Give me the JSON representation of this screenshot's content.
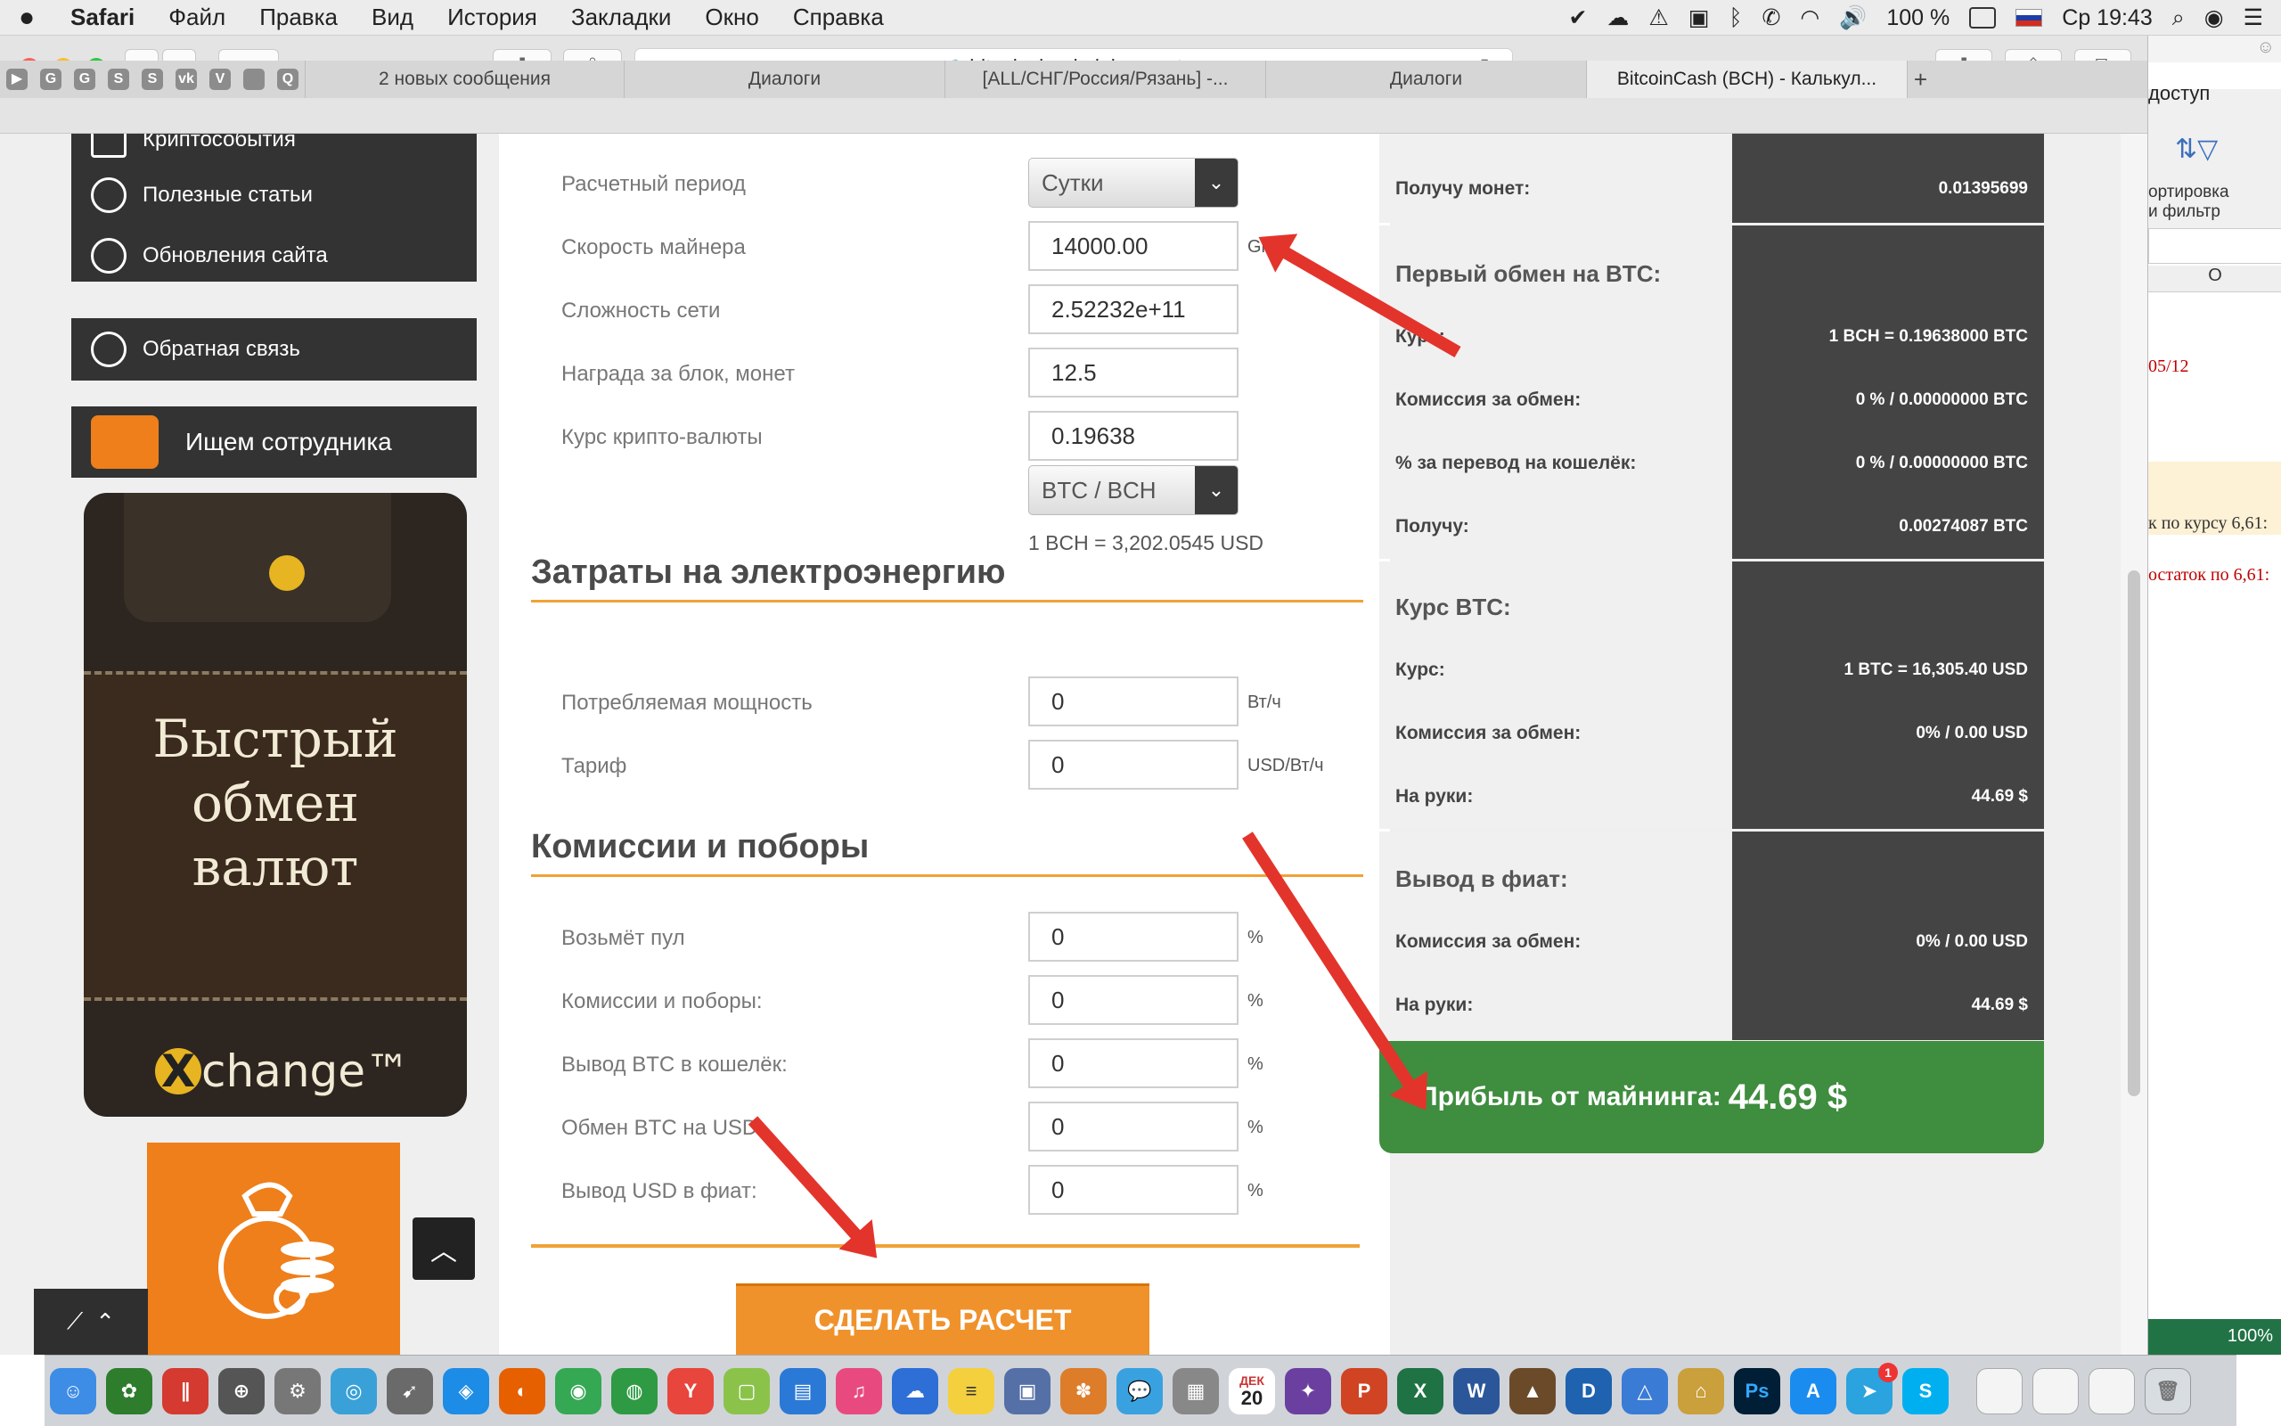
{
  "menubar": {
    "apple": "",
    "items": [
      "Safari",
      "Файл",
      "Правка",
      "Вид",
      "История",
      "Закладки",
      "Окно",
      "Справка"
    ],
    "battery": "100 %",
    "clock": "Ср 19:43"
  },
  "browser": {
    "url": "bitcoincloudmining.center",
    "tabs": [
      "2 новых сообщения",
      "Диалоги",
      "[ALL/СНГ/Россия/Рязань] -...",
      "Диалоги",
      "BitcoinCash (BCH) - Калькул..."
    ],
    "favicons": [
      "▶",
      "G",
      "G",
      "S",
      "S",
      "vk",
      "V",
      "",
      "Q"
    ],
    "new_tab": "+"
  },
  "sidebar": {
    "items": [
      "Криптособытия",
      "Полезные статьи",
      "Обновления сайта"
    ],
    "feedback": "Обратная связь",
    "hiring": "Ищем сотрудника",
    "banner_text": [
      "Быстрый",
      "обмен",
      "валют"
    ],
    "banner_brand_x": "X",
    "banner_brand": "change™",
    "up": "︿",
    "graph": "⌃"
  },
  "form": {
    "period_label": "Расчетный период",
    "period_value": "Сутки",
    "speed_label": "Скорость майнера",
    "speed_value": "14000.00",
    "speed_unit": "Gh/s",
    "difficulty_label": "Сложность сети",
    "difficulty_value": "2.52232e+11",
    "reward_label": "Награда за блок, монет",
    "reward_value": "12.5",
    "rate_label": "Курс крипто-валюты",
    "rate_value": "0.19638",
    "pair_value": "BTC / BCH",
    "pair_usd": "1 BCH = 3,202.0545 USD",
    "energy_title": "Затраты на электроэнергию",
    "power_label": "Потребляемая мощность",
    "power_value": "0",
    "power_unit": "Вт/ч",
    "tariff_label": "Тариф",
    "tariff_value": "0",
    "tariff_unit": "USD/Вт/ч",
    "fees_title": "Комиссии и поборы",
    "pool_label": "Возьмёт пул",
    "pool_value": "0",
    "fees_label": "Комиссии и поборы:",
    "fees_value": "0",
    "btc_wallet_label": "Вывод BTC в кошелёк:",
    "btc_wallet_value": "0",
    "btc_usd_label": "Обмен BTC на USD:",
    "btc_usd_value": "0",
    "usd_fiat_label": "Вывод USD в фиат:",
    "usd_fiat_value": "0",
    "percent": "%",
    "calc_button": "СДЕЛАТЬ РАСЧЕТ"
  },
  "results": {
    "coins_label": "Получу монет:",
    "coins_value": "0.01395699",
    "exch1_title": "Первый обмен на BTC:",
    "exch1_rate_label": "Курс:",
    "exch1_rate_value": "1 BCH = 0.19638000 BTC",
    "exch1_fee_label": "Комиссия за обмен:",
    "exch1_fee_value": "0 % / 0.00000000 BTC",
    "exch1_wallet_label": "% за перевод на кошелёк:",
    "exch1_wallet_value": "0 % / 0.00000000 BTC",
    "exch1_get_label": "Получу:",
    "exch1_get_value": "0.00274087 BTC",
    "btc_title": "Курс BTC:",
    "btc_rate_label": "Курс:",
    "btc_rate_value": "1 BTC = 16,305.40 USD",
    "btc_fee_label": "Комиссия за обмен:",
    "btc_fee_value": "0% / 0.00 USD",
    "btc_hand_label": "На руки:",
    "btc_hand_value": "44.69 $",
    "fiat_title": "Вывод в фиат:",
    "fiat_fee_label": "Комиссия за обмен:",
    "fiat_fee_value": "0% / 0.00 USD",
    "fiat_hand_label": "На руки:",
    "fiat_hand_value": "44.69 $",
    "profit_label": "Прибыль от майнинга:",
    "profit_value": "44.69 $"
  },
  "excel": {
    "tab": "доступ",
    "sort": "ортировка",
    "filter": "и фильтр",
    "col": "O",
    "date": "05/12",
    "row1": "к по курсу 6,61:",
    "row2": "остаток по 6,61:",
    "zoom": "100%"
  },
  "dock": {
    "calendar_month": "ДЕК",
    "calendar_day": "20",
    "badge": "1"
  }
}
